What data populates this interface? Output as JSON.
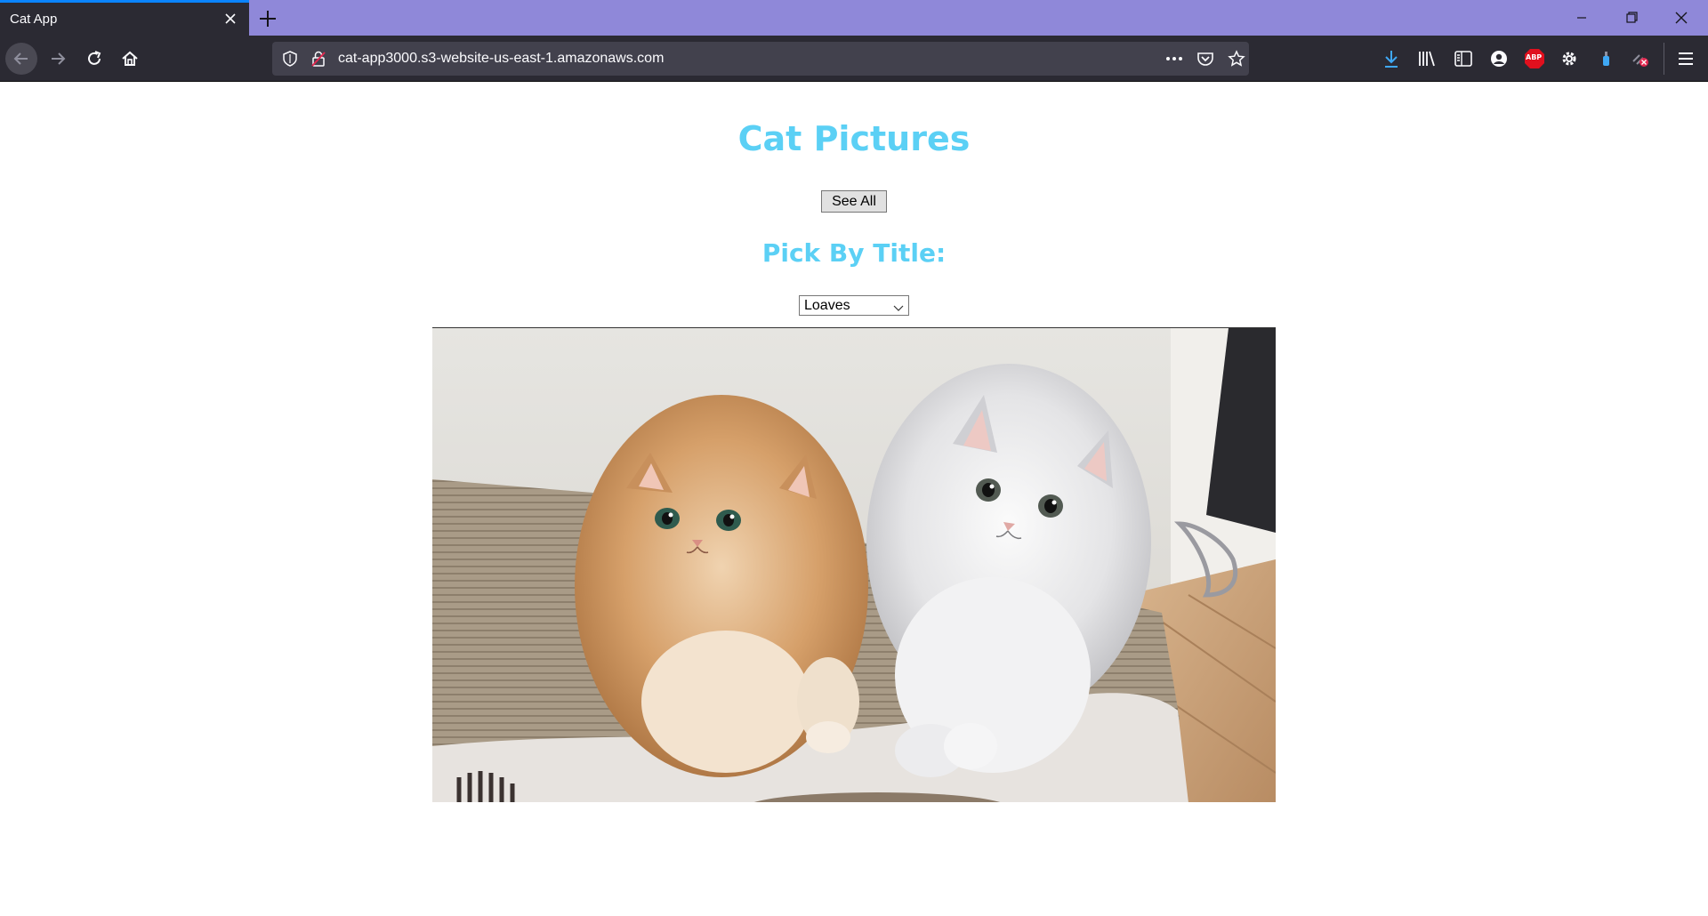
{
  "browser": {
    "tab_title": "Cat App",
    "url": "cat-app3000.s3-website-us-east-1.amazonaws.com",
    "accent_color": "#0a84ff",
    "titlebar_color": "#8f88d9"
  },
  "page": {
    "heading": "Cat Pictures",
    "see_all_label": "See All",
    "subheading": "Pick By Title:",
    "select_value": "Loaves",
    "heading_color": "#5bd0f5"
  },
  "photo": {
    "subject": "two fluffy cats on a cardboard scratcher"
  },
  "icons": [
    "close-icon",
    "plus-icon",
    "minimize-icon",
    "restore-icon",
    "back-icon",
    "forward-icon",
    "reload-icon",
    "home-icon",
    "shield-icon",
    "insecure-lock-icon",
    "more-icon",
    "pocket-icon",
    "star-icon",
    "download-icon",
    "library-icon",
    "sidebar-icon",
    "account-icon",
    "adblock-icon",
    "gear-icon",
    "extension-icon",
    "extension-icon-2",
    "menu-icon"
  ],
  "adblock_badge": "ABP"
}
